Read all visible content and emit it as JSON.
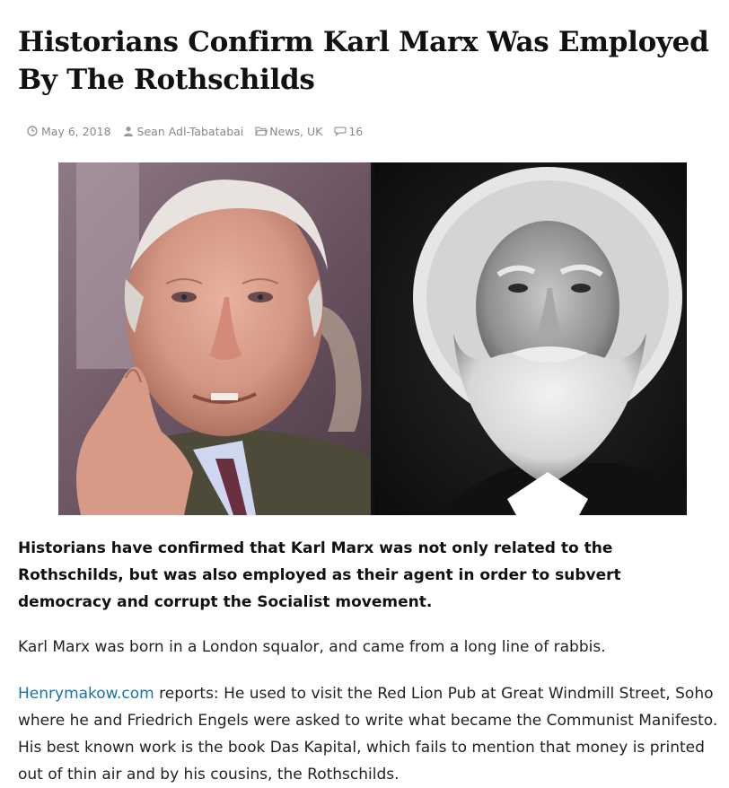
{
  "article": {
    "title": "Historians Confirm Karl Marx Was Employed By The Rothschilds",
    "meta": {
      "date": "May 6, 2018",
      "author": "Sean Adl-Tabatabai",
      "categories": "News, UK",
      "comment_count": "16",
      "icons": [
        "clock-icon",
        "user-icon",
        "folder-icon",
        "comment-icon"
      ]
    },
    "hero_image": {
      "left_subject": "portrait-elderly-man",
      "right_subject": "portrait-bearded-man"
    },
    "lead": "Historians have confirmed that Karl Marx was not only related to the Rothschilds, but was also employed as their agent in order to subvert democracy and corrupt the Socialist movement.",
    "paragraph1": "Karl Marx was born in a London squalor, and came from a long line of rabbis.",
    "paragraph2": {
      "link_text": "Henrymakow.com",
      "text": " reports: He used to visit the Red Lion Pub at Great Windmill Street, Soho where he and Friedrich Engels were asked to write what became the Communist Manifesto. His best known work is the book Das Kapital, which fails to mention that money is printed out of thin air and by his cousins, the Rothschilds."
    }
  },
  "colors": {
    "link": "#1a73a8",
    "meta": "#888888",
    "text": "#111111"
  }
}
